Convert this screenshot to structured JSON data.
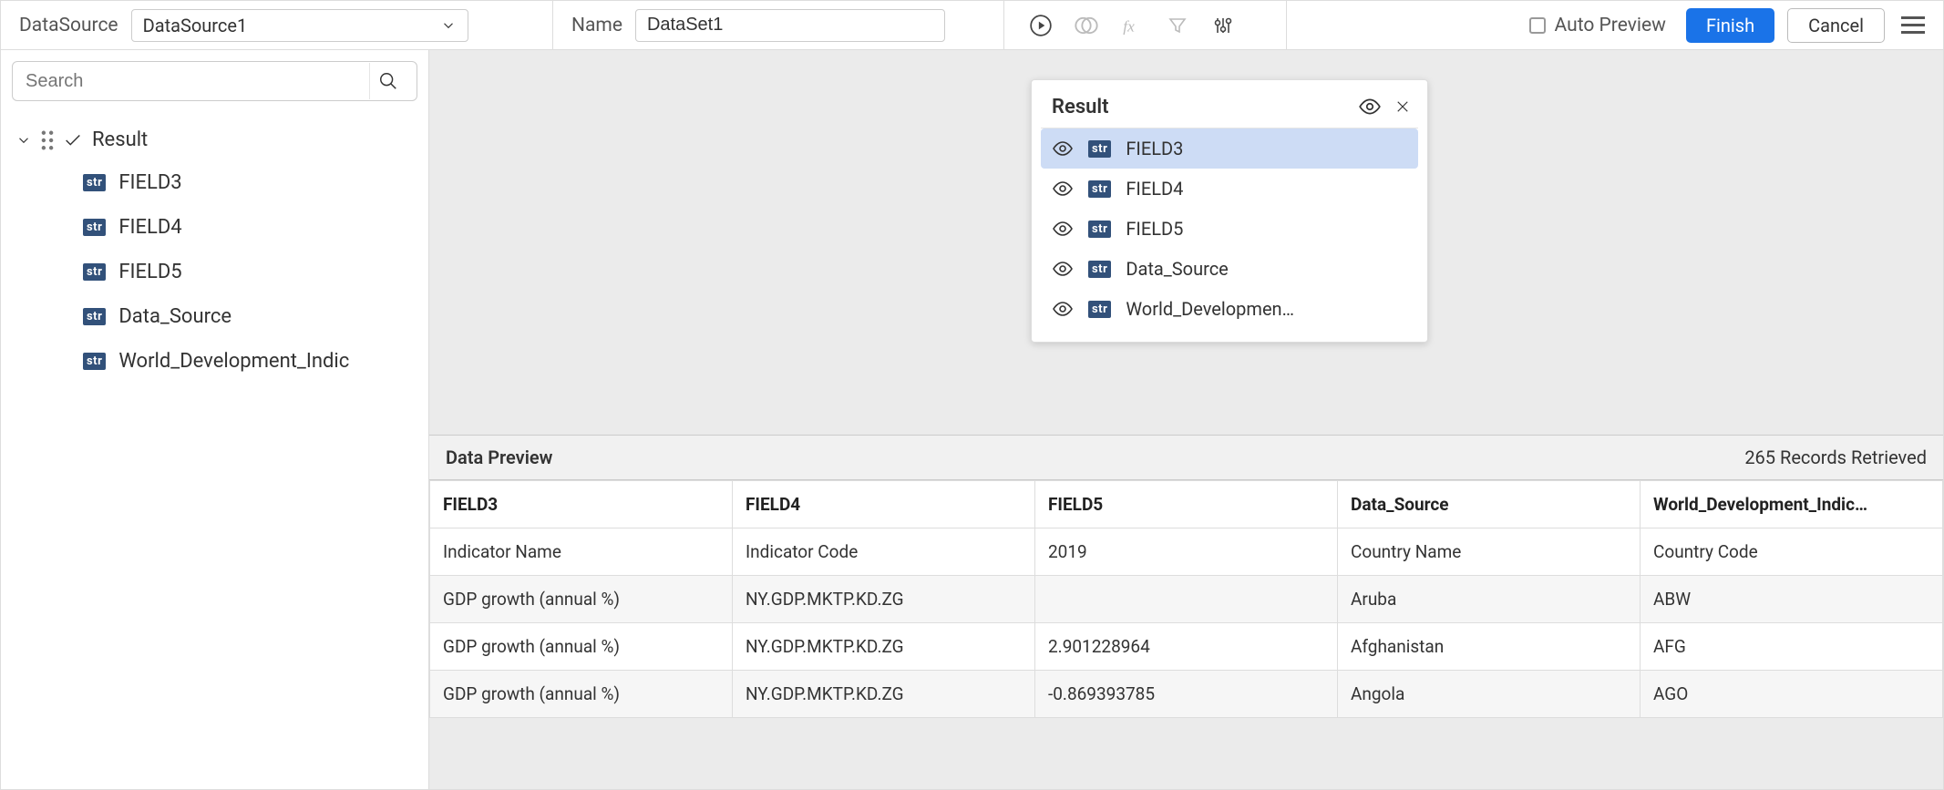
{
  "toolbar": {
    "datasource_label": "DataSource",
    "datasource_value": "DataSource1",
    "name_label": "Name",
    "name_value": "DataSet1",
    "auto_preview_label": "Auto Preview",
    "finish_label": "Finish",
    "cancel_label": "Cancel"
  },
  "sidebar": {
    "search_placeholder": "Search",
    "root_label": "Result",
    "fields": [
      {
        "type": "str",
        "label": "FIELD3"
      },
      {
        "type": "str",
        "label": "FIELD4"
      },
      {
        "type": "str",
        "label": "FIELD5"
      },
      {
        "type": "str",
        "label": "Data_Source"
      },
      {
        "type": "str",
        "label": "World_Development_Indic"
      }
    ]
  },
  "popover": {
    "title": "Result",
    "items": [
      {
        "type": "str",
        "label": "FIELD3",
        "selected": true
      },
      {
        "type": "str",
        "label": "FIELD4",
        "selected": false
      },
      {
        "type": "str",
        "label": "FIELD5",
        "selected": false
      },
      {
        "type": "str",
        "label": "Data_Source",
        "selected": false
      },
      {
        "type": "str",
        "label": "World_Developmen…",
        "selected": false
      }
    ]
  },
  "preview": {
    "title": "Data Preview",
    "records_text": "265 Records Retrieved",
    "columns": [
      "FIELD3",
      "FIELD4",
      "FIELD5",
      "Data_Source",
      "World_Development_Indic…"
    ],
    "rows": [
      [
        "Indicator Name",
        "Indicator Code",
        "2019",
        "Country Name",
        "Country Code"
      ],
      [
        "GDP growth (annual %)",
        "NY.GDP.MKTP.KD.ZG",
        "",
        "Aruba",
        "ABW"
      ],
      [
        "GDP growth (annual %)",
        "NY.GDP.MKTP.KD.ZG",
        "2.901228964",
        "Afghanistan",
        "AFG"
      ],
      [
        "GDP growth (annual %)",
        "NY.GDP.MKTP.KD.ZG",
        "-0.869393785",
        "Angola",
        "AGO"
      ]
    ]
  }
}
